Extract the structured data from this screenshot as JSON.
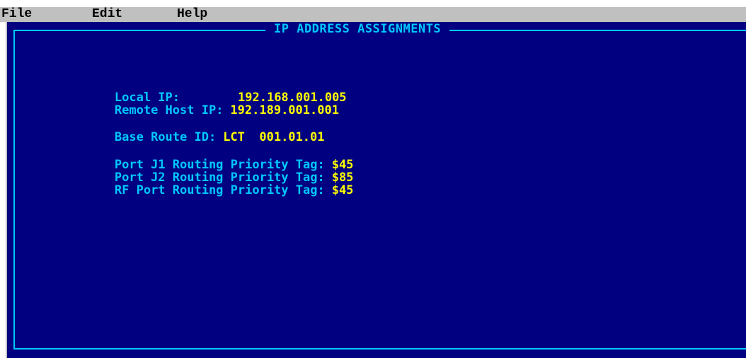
{
  "menu": {
    "file": "File",
    "edit": "Edit",
    "help": "Help"
  },
  "panel": {
    "title": "IP ADDRESS ASSIGNMENTS"
  },
  "fields": {
    "local_ip": {
      "label": "Local IP:",
      "value": "192.168.001.005"
    },
    "remote_host_ip": {
      "label": "Remote Host IP:",
      "value": "192.189.001.001"
    },
    "base_route_id": {
      "label": "Base Route ID:",
      "value": "LCT  001.01.01"
    },
    "port_j1": {
      "label": "Port J1 Routing Priority Tag:",
      "value": "$45"
    },
    "port_j2": {
      "label": "Port J2 Routing Priority Tag:",
      "value": "$85"
    },
    "rf_port": {
      "label": "RF Port Routing Priority Tag:",
      "value": "$45"
    }
  },
  "colors": {
    "background": "#000080",
    "label": "#00c8ff",
    "value": "#ffff00",
    "menubar": "#c0c0c0"
  }
}
